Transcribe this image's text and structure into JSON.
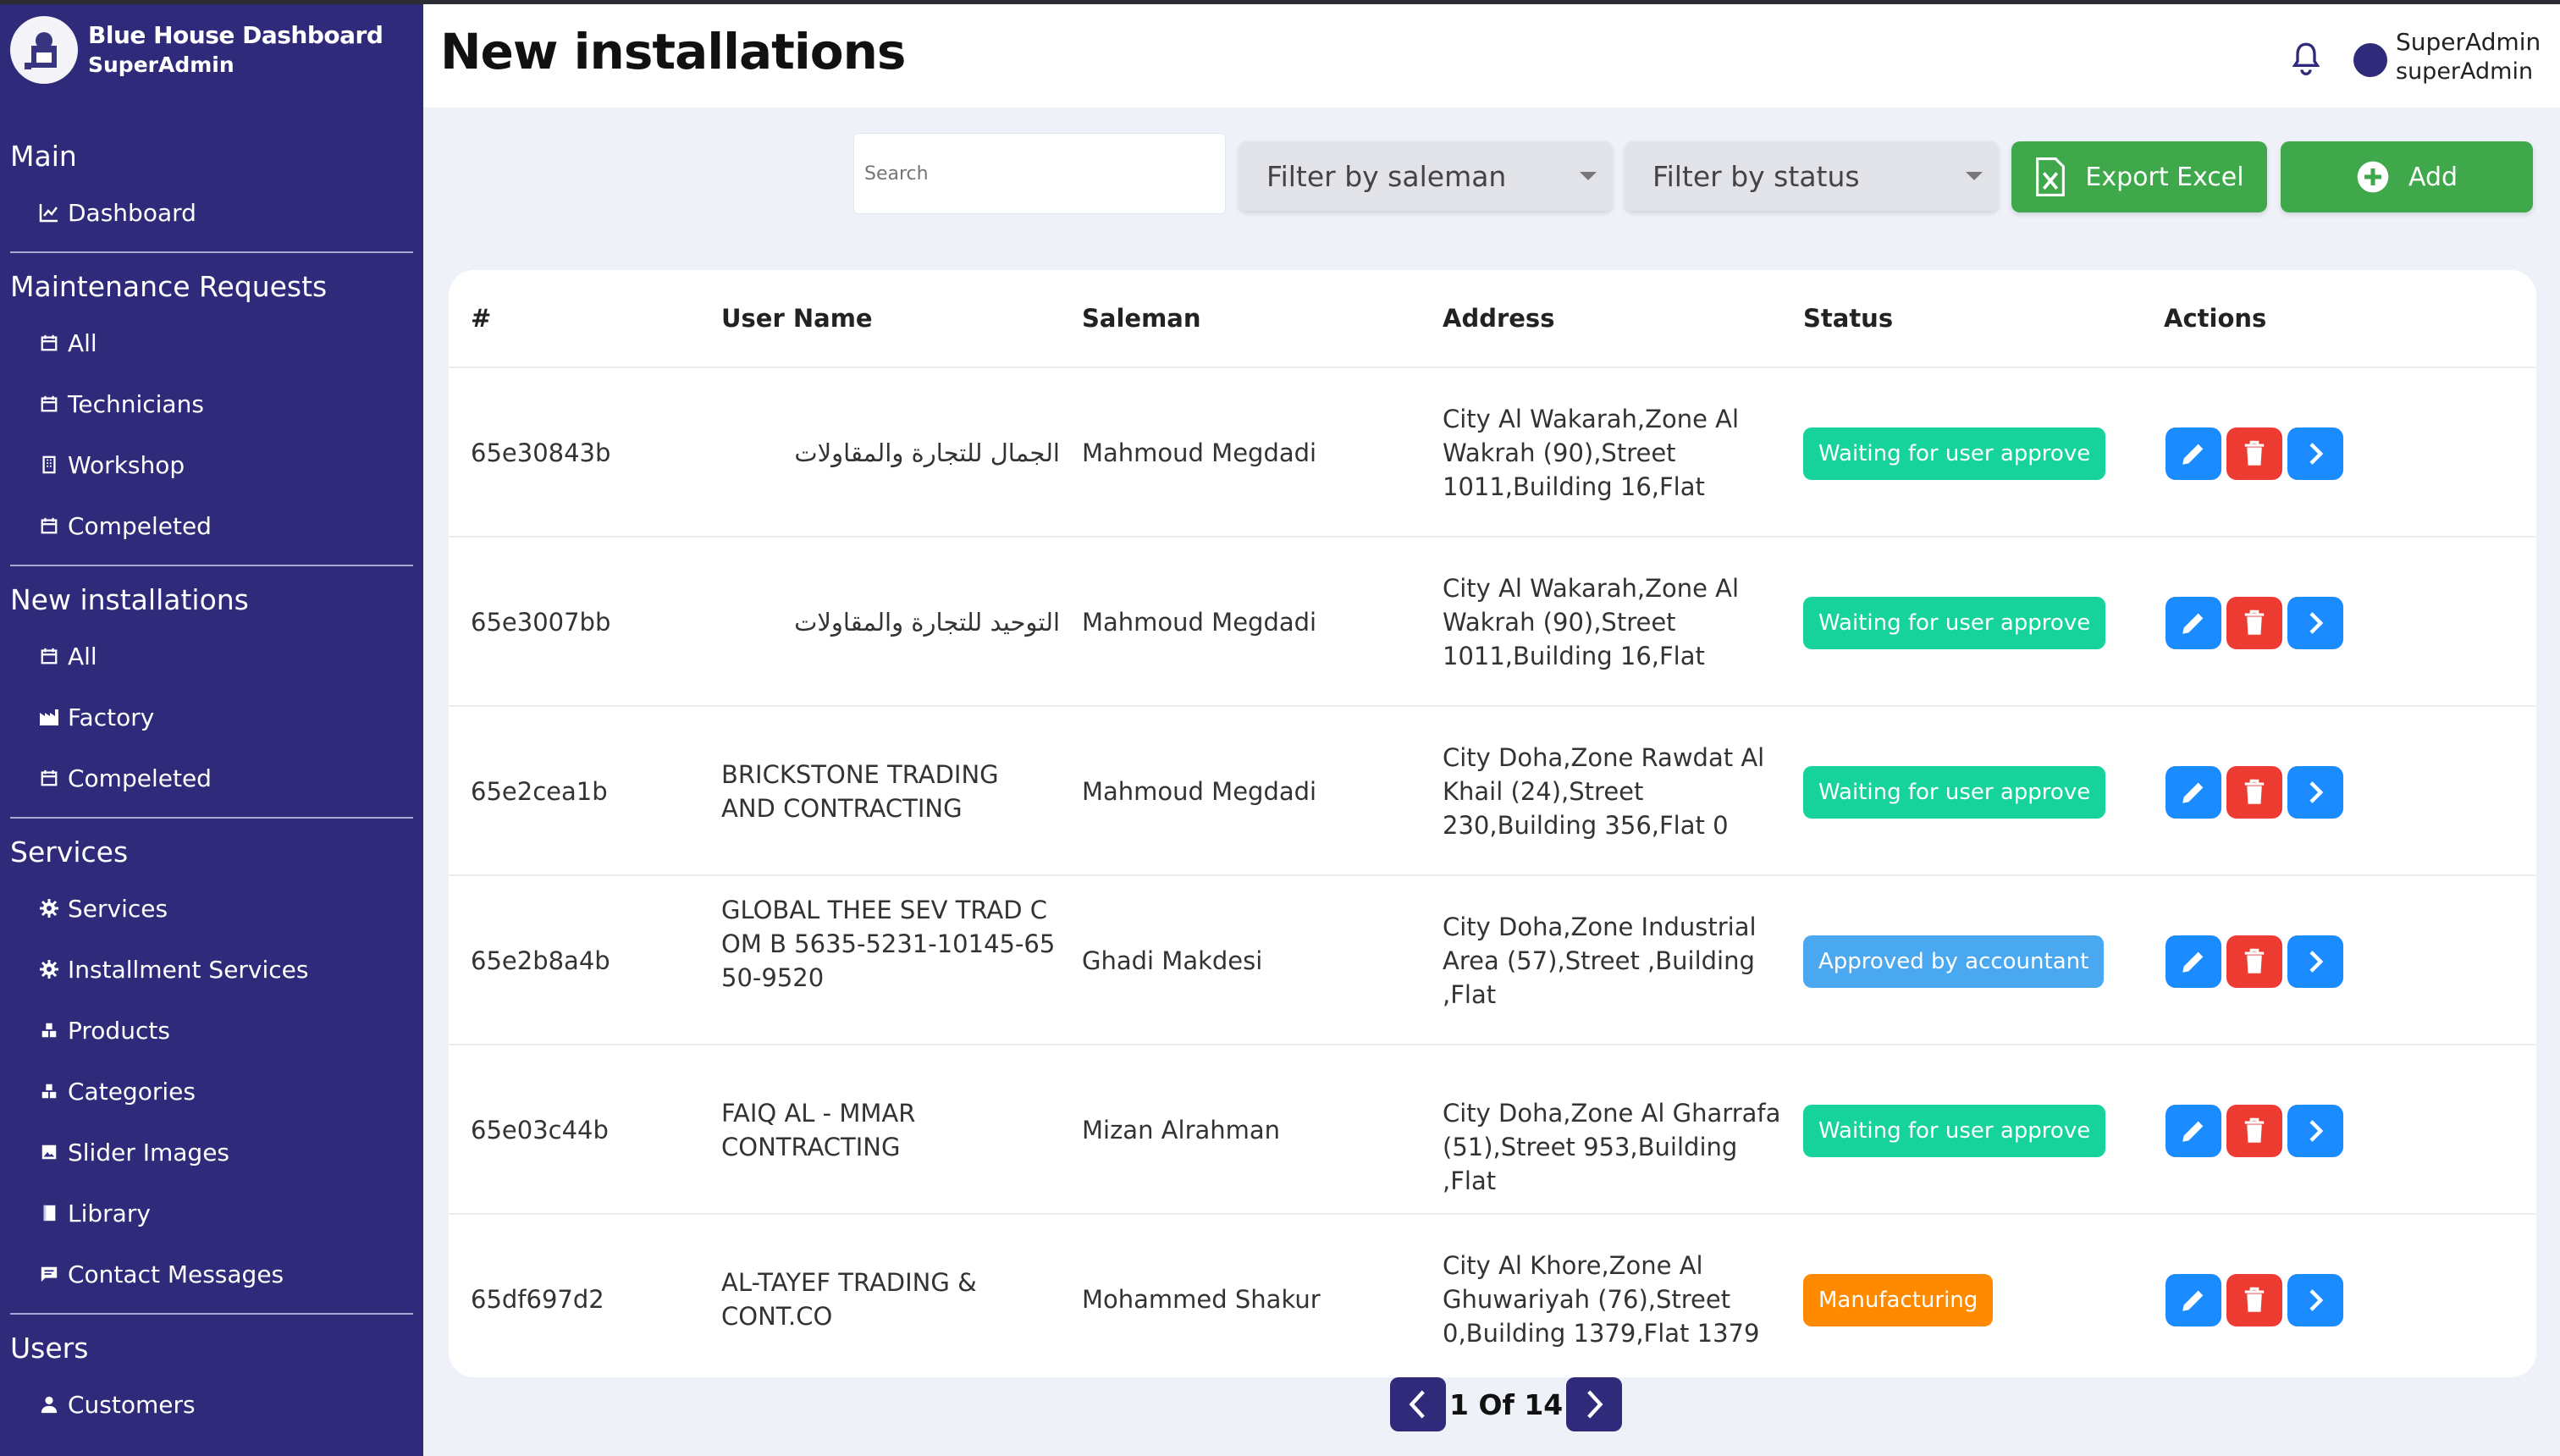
{
  "brand": {
    "title": "Blue House Dashboard",
    "subtitle": "SuperAdmin"
  },
  "sidebar": {
    "sections": [
      {
        "title": "Main",
        "items": [
          {
            "label": "Dashboard",
            "icon": "chart-icon"
          }
        ]
      },
      {
        "title": "Maintenance Requests",
        "items": [
          {
            "label": "All",
            "icon": "calendar-icon"
          },
          {
            "label": "Technicians",
            "icon": "calendar-icon"
          },
          {
            "label": "Workshop",
            "icon": "building-icon"
          },
          {
            "label": "Compeleted",
            "icon": "calendar-icon"
          }
        ]
      },
      {
        "title": "New installations",
        "items": [
          {
            "label": "All",
            "icon": "calendar-icon"
          },
          {
            "label": "Factory",
            "icon": "factory-icon"
          },
          {
            "label": "Compeleted",
            "icon": "calendar-icon"
          }
        ]
      },
      {
        "title": "Services",
        "items": [
          {
            "label": "Services",
            "icon": "gear-icon"
          },
          {
            "label": "Installment Services",
            "icon": "gear-icon"
          },
          {
            "label": "Products",
            "icon": "cubes-icon"
          },
          {
            "label": "Categories",
            "icon": "cubes-icon"
          },
          {
            "label": "Slider Images",
            "icon": "image-icon"
          },
          {
            "label": "Library",
            "icon": "book-icon"
          },
          {
            "label": "Contact Messages",
            "icon": "message-icon"
          }
        ]
      },
      {
        "title": "Users",
        "items": [
          {
            "label": "Customers",
            "icon": "user-icon"
          }
        ]
      }
    ]
  },
  "header": {
    "title": "New installations",
    "user_name": "SuperAdmin",
    "user_role": "superAdmin"
  },
  "toolbar": {
    "search_placeholder": "Search",
    "filter_saleman": "Filter by saleman",
    "filter_status": "Filter by status",
    "export_label": "Export Excel",
    "add_label": "Add"
  },
  "table": {
    "columns": [
      "#",
      "User Name",
      "Saleman",
      "Address",
      "Status",
      "Actions"
    ],
    "rows": [
      {
        "id": "65e30843b",
        "user": "الجمال  للتجارة والمقاولات",
        "saleman": "Mahmoud Megdadi",
        "address": "City Al Wakarah,Zone Al Wakrah (90),Street 1011,Building 16,Flat",
        "status": "Waiting for user approve",
        "status_color": "#15d39a"
      },
      {
        "id": "65e3007bb",
        "user": "التوحيد  للتجارة والمقاولات",
        "saleman": "Mahmoud Megdadi",
        "address": "City Al Wakarah,Zone Al Wakrah (90),Street 1011,Building 16,Flat",
        "status": "Waiting for user approve",
        "status_color": "#15d39a"
      },
      {
        "id": "65e2cea1b",
        "user": "BRICKSTONE TRADING  AND CONTRACTING",
        "saleman": "Mahmoud Megdadi",
        "address": "City Doha,Zone Rawdat Al Khail (24),Street 230,Building 356,Flat 0",
        "status": "Waiting for user approve",
        "status_color": "#15d39a"
      },
      {
        "id": "65e2b8a4b",
        "user": "GLOBAL THEE SEV TRAD COM B 5635-5231-10145-6550-9520",
        "saleman": "Ghadi Makdesi",
        "address": "City Doha,Zone Industrial Area (57),Street ,Building ,Flat",
        "status": "Approved by accountant",
        "status_color": "#4aa8f0"
      },
      {
        "id": "65e03c44b",
        "user": "FAIQ AL - MMAR CONTRACTING",
        "saleman": "Mizan Alrahman",
        "address": "City Doha,Zone Al Gharrafa (51),Street 953,Building ,Flat",
        "status": "Waiting for user approve",
        "status_color": "#15d39a"
      },
      {
        "id": "65df697d2",
        "user": "AL-TAYEF TRADING & CONT.CO",
        "saleman": "Mohammed Shakur",
        "address": "City Al Khore,Zone Al Ghuwariyah (76),Street 0,Building 1379,Flat 1379",
        "status": "Manufacturing",
        "status_color": "#ff8a00"
      }
    ]
  },
  "pagination": {
    "text": "1 Of 14"
  }
}
